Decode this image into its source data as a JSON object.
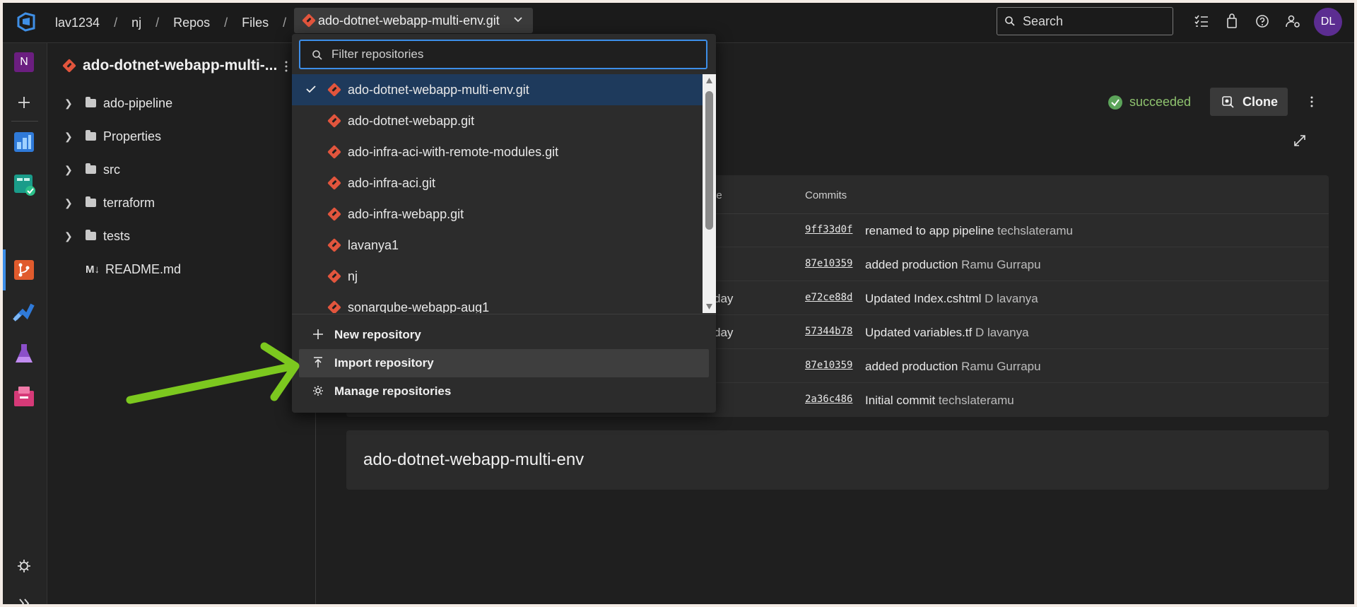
{
  "breadcrumb": [
    "lav1234",
    "nj",
    "Repos",
    "Files"
  ],
  "selected_repo": "ado-dotnet-webapp-multi-env.git",
  "search": {
    "placeholder": "Search"
  },
  "user": {
    "initials": "DL"
  },
  "project": {
    "initial": "N"
  },
  "tree": {
    "title": "ado-dotnet-webapp-multi-...",
    "folders": [
      "ado-pipeline",
      "Properties",
      "src",
      "terraform",
      "tests"
    ],
    "file": "README.md"
  },
  "build": {
    "status": "succeeded"
  },
  "clone_label": "Clone",
  "commits_table": {
    "age_header_fragment": "ge",
    "commits_header": "Commits",
    "rows": [
      {
        "age": "",
        "hash": "9ff33d0f",
        "message": "renamed to app pipeline",
        "author": "techslateramu"
      },
      {
        "age": "",
        "hash": "87e10359",
        "message": "added production",
        "author": "Ramu Gurrapu"
      },
      {
        "age": "day",
        "hash": "e72ce88d",
        "message": "Updated Index.cshtml",
        "author": "D lavanya"
      },
      {
        "age": "day",
        "hash": "57344b78",
        "message": "Updated variables.tf",
        "author": "D lavanya"
      },
      {
        "age": "",
        "hash": "87e10359",
        "message": "added production",
        "author": "Ramu Gurrapu"
      },
      {
        "age": "",
        "hash": "2a36c486",
        "message": "Initial commit",
        "author": "techslateramu"
      }
    ]
  },
  "readme_heading": "ado-dotnet-webapp-multi-env",
  "dropdown": {
    "filter_placeholder": "Filter repositories",
    "repos": [
      "ado-dotnet-webapp-multi-env.git",
      "ado-dotnet-webapp.git",
      "ado-infra-aci-with-remote-modules.git",
      "ado-infra-aci.git",
      "ado-infra-webapp.git",
      "lavanya1",
      "nj",
      "sonarqube-webapp-aug1"
    ],
    "actions": [
      "New repository",
      "Import repository",
      "Manage repositories"
    ]
  },
  "colors": {
    "accent": "#3d8ee8",
    "git": "#e2553d",
    "success": "#5ca45a",
    "arrow": "#7cc81f"
  }
}
